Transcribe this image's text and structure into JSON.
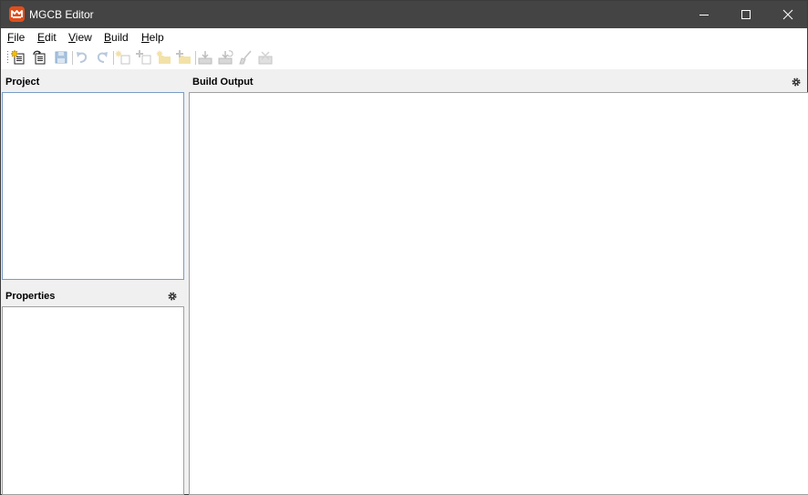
{
  "window": {
    "title": "MGCB Editor",
    "accent": "#e04e1b",
    "titlebar_color": "#444444"
  },
  "menu": {
    "items": [
      {
        "label": "File",
        "mnemonic": "F"
      },
      {
        "label": "Edit",
        "mnemonic": "E"
      },
      {
        "label": "View",
        "mnemonic": "V"
      },
      {
        "label": "Build",
        "mnemonic": "B"
      },
      {
        "label": "Help",
        "mnemonic": "H"
      }
    ]
  },
  "toolbar": {
    "buttons": [
      {
        "icon": "new-project-icon",
        "enabled": true
      },
      {
        "icon": "open-project-icon",
        "enabled": true
      },
      {
        "icon": "save-icon",
        "enabled": false
      },
      {
        "icon": "undo-icon",
        "enabled": false
      },
      {
        "icon": "redo-icon",
        "enabled": false
      },
      {
        "icon": "new-item-icon",
        "enabled": false
      },
      {
        "icon": "add-existing-item-icon",
        "enabled": false
      },
      {
        "icon": "new-folder-icon",
        "enabled": false
      },
      {
        "icon": "add-existing-folder-icon",
        "enabled": false
      },
      {
        "icon": "build-icon",
        "enabled": false
      },
      {
        "icon": "rebuild-icon",
        "enabled": false
      },
      {
        "icon": "clean-icon",
        "enabled": false
      },
      {
        "icon": "cancel-build-icon",
        "enabled": false
      }
    ]
  },
  "panels": {
    "project": {
      "title": "Project"
    },
    "properties": {
      "title": "Properties"
    },
    "build_output": {
      "title": "Build Output"
    }
  }
}
